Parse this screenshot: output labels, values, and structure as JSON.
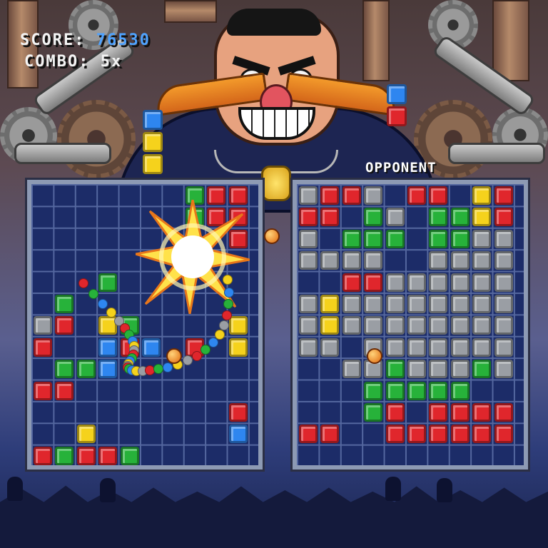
{
  "hud": {
    "score_label": "SCORE:",
    "score_value": "76530",
    "combo_label": "COMBO:",
    "combo_value": "5x"
  },
  "opponent_label": "OPPONENT",
  "colors": {
    "red": "#e0262c",
    "green": "#27b23a",
    "yellow": "#f5d21c",
    "blue": "#2e86f0",
    "grey": "#9a9ea4",
    "board_bg": "#1c2c68"
  },
  "player_board": {
    "grid": [
      [
        ".",
        ".",
        ".",
        ".",
        ".",
        ".",
        ".",
        "G",
        "R",
        "R"
      ],
      [
        ".",
        ".",
        ".",
        ".",
        ".",
        ".",
        ".",
        "G",
        "R",
        "R"
      ],
      [
        ".",
        ".",
        ".",
        ".",
        ".",
        ".",
        ".",
        ".",
        ".",
        "R"
      ],
      [
        ".",
        ".",
        ".",
        ".",
        ".",
        ".",
        ".",
        ".",
        ".",
        "."
      ],
      [
        ".",
        ".",
        ".",
        "G",
        ".",
        ".",
        ".",
        ".",
        ".",
        "."
      ],
      [
        ".",
        "G",
        ".",
        ".",
        ".",
        ".",
        ".",
        ".",
        ".",
        "."
      ],
      [
        "X",
        "R",
        ".",
        "Y",
        "G",
        ".",
        ".",
        ".",
        ".",
        "Y"
      ],
      [
        "R",
        ".",
        ".",
        "B",
        "R",
        "B",
        ".",
        "R",
        ".",
        "Y"
      ],
      [
        ".",
        "G",
        "G",
        "B",
        ".",
        ".",
        ".",
        ".",
        ".",
        "."
      ],
      [
        "R",
        "R",
        ".",
        ".",
        ".",
        ".",
        ".",
        ".",
        ".",
        "."
      ],
      [
        ".",
        ".",
        ".",
        ".",
        ".",
        ".",
        ".",
        ".",
        ".",
        "R"
      ],
      [
        ".",
        ".",
        "Y",
        ".",
        ".",
        ".",
        ".",
        ".",
        ".",
        "B"
      ],
      [
        "R",
        "G",
        "R",
        "R",
        "G",
        ".",
        ".",
        ".",
        ".",
        "."
      ]
    ]
  },
  "opponent_board": {
    "grid": [
      [
        "X",
        "R",
        "R",
        "X",
        ".",
        "R",
        "R",
        ".",
        "Y",
        "R"
      ],
      [
        "R",
        "R",
        ".",
        "G",
        "X",
        ".",
        "G",
        "G",
        "Y",
        "R"
      ],
      [
        "X",
        ".",
        "G",
        "G",
        "G",
        ".",
        "G",
        "G",
        "X",
        "X"
      ],
      [
        "X",
        "X",
        "X",
        "X",
        ".",
        ".",
        "X",
        "X",
        "X",
        "X"
      ],
      [
        ".",
        ".",
        "R",
        "R",
        "X",
        "X",
        "X",
        "X",
        "X",
        "X"
      ],
      [
        "X",
        "Y",
        "X",
        "X",
        "X",
        "X",
        "X",
        "X",
        "X",
        "X"
      ],
      [
        "X",
        "Y",
        "X",
        "X",
        "X",
        "X",
        "X",
        "X",
        "X",
        "X"
      ],
      [
        "X",
        "X",
        ".",
        "X",
        "X",
        "X",
        "X",
        "X",
        "X",
        "X"
      ],
      [
        ".",
        ".",
        "X",
        "X",
        "G",
        "X",
        "X",
        "X",
        "G",
        "X"
      ],
      [
        ".",
        ".",
        ".",
        "G",
        "G",
        "G",
        "G",
        "G",
        ".",
        "."
      ],
      [
        ".",
        ".",
        ".",
        "G",
        "R",
        ".",
        "R",
        "R",
        "R",
        "R"
      ],
      [
        "R",
        "R",
        ".",
        ".",
        "R",
        "R",
        "R",
        "R",
        "R",
        "R"
      ],
      [
        ".",
        ".",
        ".",
        ".",
        ".",
        ".",
        ".",
        ".",
        ".",
        "."
      ]
    ]
  },
  "next_pieces": {
    "player": [
      "blue",
      "yellow",
      "yellow"
    ],
    "opponent": [
      "blue",
      "red"
    ]
  }
}
